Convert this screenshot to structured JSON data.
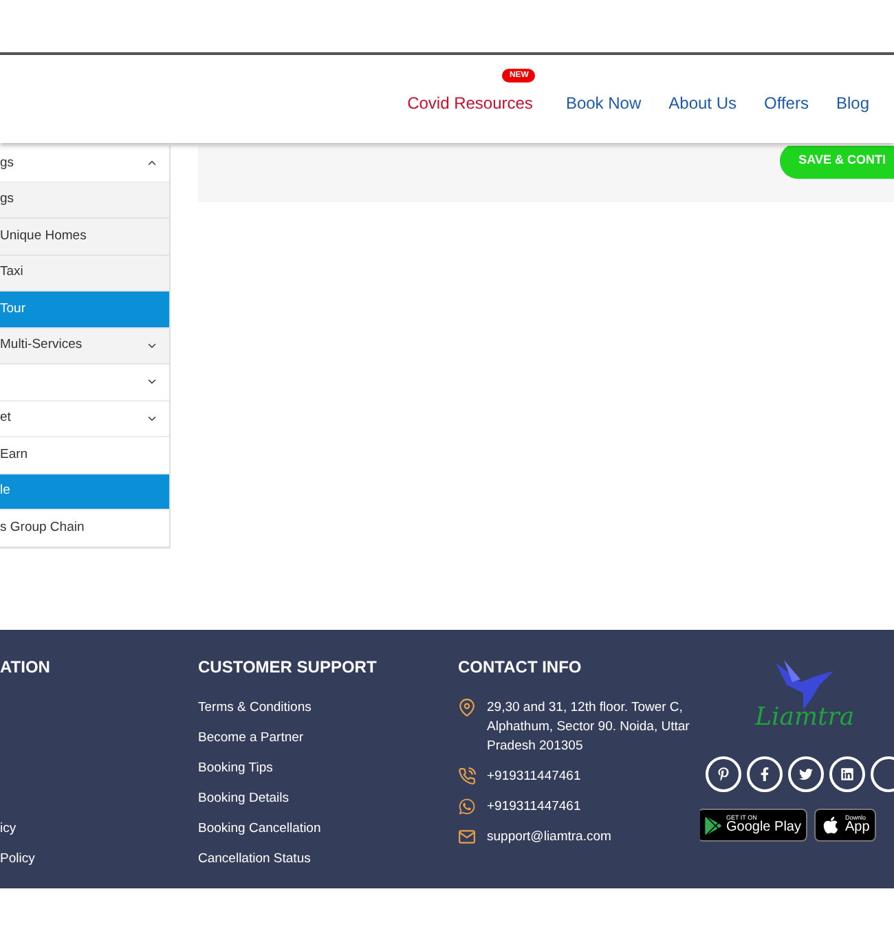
{
  "nav": {
    "items": [
      {
        "label": "Covid Resources",
        "badge": "NEW",
        "kind": "highlight"
      },
      {
        "label": "Book Now",
        "kind": "plain"
      },
      {
        "label": "About Us",
        "kind": "plain"
      },
      {
        "label": "Offers",
        "kind": "plain"
      },
      {
        "label": "Blog",
        "kind": "plain"
      }
    ]
  },
  "sidebar": {
    "items": [
      {
        "label": "gs",
        "kind": "group",
        "selected": false,
        "expanded": true
      },
      {
        "label": "gs",
        "kind": "child",
        "selected": false
      },
      {
        "label": "Unique Homes",
        "kind": "child",
        "selected": false
      },
      {
        "label": "Taxi",
        "kind": "child",
        "selected": false
      },
      {
        "label": "Tour",
        "kind": "child",
        "selected": true
      },
      {
        "label": "Multi-Services",
        "kind": "child",
        "selected": false,
        "expanded": false
      },
      {
        "kind": "group",
        "selected": false,
        "expanded": false
      },
      {
        "label": "et",
        "kind": "group",
        "selected": false,
        "expanded": false
      },
      {
        "label": "Earn",
        "kind": "group",
        "selected": false
      },
      {
        "label": "le",
        "kind": "group",
        "selected": true
      },
      {
        "label": "s Group Chain",
        "kind": "group",
        "selected": false
      }
    ]
  },
  "save_button": {
    "label": "SAVE & CONTI"
  },
  "footer": {
    "columns": [
      {
        "heading": "ATION",
        "links": [
          "icy",
          "Policy"
        ]
      },
      {
        "heading": "CUSTOMER SUPPORT",
        "links": [
          "Terms & Conditions",
          "Become a Partner",
          "Booking Tips",
          "Booking Details",
          "Booking Cancellation",
          "Cancellation Status"
        ]
      }
    ],
    "contact": {
      "heading": "CONTACT INFO",
      "items": [
        {
          "kind": "address",
          "text": "29,30 and 31, 12th floor. Tower C, Alphathum, Sector 90. Noida, Uttar Pradesh 201305"
        },
        {
          "kind": "phone",
          "text": "+919311447461"
        },
        {
          "kind": "whatsapp",
          "text": "+919311447461"
        },
        {
          "kind": "email",
          "text": "support@liamtra.com"
        }
      ]
    },
    "logo": {
      "text": "Liamtra"
    },
    "apps": [
      {
        "kind": "google",
        "small": "GET IT ON",
        "big": "Google Play"
      },
      {
        "kind": "apple",
        "small": "Downlo",
        "big": "App"
      }
    ]
  }
}
